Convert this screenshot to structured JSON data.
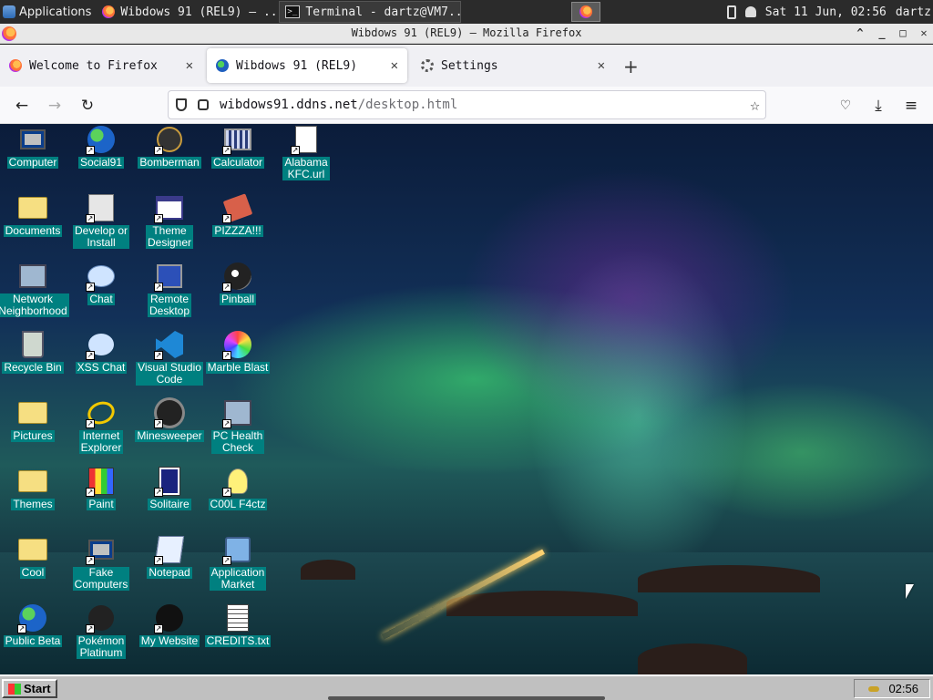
{
  "system_panel": {
    "applications_label": "Applications",
    "tasks": [
      {
        "label": "Wibdows 91 (REL9) — ..."
      },
      {
        "label": "Terminal - dartz@VM7..."
      }
    ],
    "clock": "Sat 11 Jun, 02:56",
    "user": "dartz"
  },
  "window": {
    "title": "Wibdows 91 (REL9) — Mozilla Firefox"
  },
  "tabs": [
    {
      "label": "Welcome to Firefox",
      "active": false
    },
    {
      "label": "Wibdows 91 (REL9)",
      "active": true
    },
    {
      "label": "Settings",
      "active": false
    }
  ],
  "urlbar": {
    "host": "wibdows91.ddns.net",
    "path": "/desktop.html"
  },
  "desktop_icons": [
    {
      "label": "Computer",
      "icon": "computer-icon",
      "shortcut": false
    },
    {
      "label": "Social91",
      "icon": "globe-icon",
      "shortcut": true
    },
    {
      "label": "Bomberman",
      "icon": "bomb-icon",
      "shortcut": true
    },
    {
      "label": "Calculator",
      "icon": "calculator-icon",
      "shortcut": true
    },
    {
      "label": "Alabama\nKFC.url",
      "icon": "internet-shortcut-icon",
      "shortcut": true
    },
    {
      "label": "Documents",
      "icon": "folder-icon",
      "shortcut": false
    },
    {
      "label": "Develop or\nInstall",
      "icon": "help-icon",
      "shortcut": true
    },
    {
      "label": "Theme\nDesigner",
      "icon": "window-icon",
      "shortcut": true
    },
    {
      "label": "PIZZZA!!!",
      "icon": "pizza-icon",
      "shortcut": true
    },
    {
      "label": "Network\nNeighborhood",
      "icon": "network-icon",
      "shortcut": false
    },
    {
      "label": "Chat",
      "icon": "chat-icon",
      "shortcut": true
    },
    {
      "label": "Remote\nDesktop",
      "icon": "remote-desktop-icon",
      "shortcut": true
    },
    {
      "label": "Pinball",
      "icon": "8ball-icon",
      "shortcut": true
    },
    {
      "label": "Recycle Bin",
      "icon": "recycle-bin-icon",
      "shortcut": false
    },
    {
      "label": "XSS Chat",
      "icon": "warning-chat-icon",
      "shortcut": true
    },
    {
      "label": "Visual Studio\nCode",
      "icon": "vscode-icon",
      "shortcut": true
    },
    {
      "label": "Marble Blast",
      "icon": "marble-icon",
      "shortcut": true
    },
    {
      "label": "Pictures",
      "icon": "folder-icon",
      "shortcut": false
    },
    {
      "label": "Internet\nExplorer",
      "icon": "internet-explorer-icon",
      "shortcut": true
    },
    {
      "label": "Minesweeper",
      "icon": "mine-icon",
      "shortcut": true
    },
    {
      "label": "PC Health\nCheck",
      "icon": "health-check-icon",
      "shortcut": true
    },
    {
      "label": "Themes",
      "icon": "folder-icon",
      "shortcut": false
    },
    {
      "label": "Paint",
      "icon": "paint-icon",
      "shortcut": true
    },
    {
      "label": "Solitaire",
      "icon": "cards-icon",
      "shortcut": true
    },
    {
      "label": "C00L F4ctz",
      "icon": "lightbulb-icon",
      "shortcut": true
    },
    {
      "label": "Cool",
      "icon": "folder-icon",
      "shortcut": false
    },
    {
      "label": "Fake\nComputers",
      "icon": "computer-icon",
      "shortcut": true
    },
    {
      "label": "Notepad",
      "icon": "notepad-icon",
      "shortcut": true
    },
    {
      "label": "Application\nMarket",
      "icon": "shopping-bag-icon",
      "shortcut": true
    },
    {
      "label": "Public Beta",
      "icon": "globe-icon",
      "shortcut": true
    },
    {
      "label": "Pokémon\nPlatinum",
      "icon": "pikachu-icon",
      "shortcut": true
    },
    {
      "label": "My Website",
      "icon": "github-icon",
      "shortcut": true
    },
    {
      "label": "CREDITS.txt",
      "icon": "text-file-icon",
      "shortcut": false
    }
  ],
  "wibdows_taskbar": {
    "start_label": "Start",
    "clock": "02:56"
  },
  "colors": {
    "icon_label_bg": "#008080",
    "taskbar_gray": "#c0c0c0",
    "panel_dark": "#2b2b2b"
  }
}
